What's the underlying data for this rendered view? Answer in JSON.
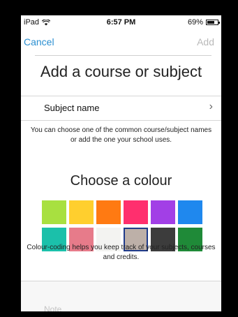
{
  "status_bar": {
    "device": "iPad",
    "time": "6:57 PM",
    "battery": "69%",
    "battery_level": 0.69
  },
  "nav": {
    "cancel_label": "Cancel",
    "add_label": "Add"
  },
  "page_title": "Add a course or subject",
  "subject_row": {
    "label": "Subject name",
    "chevron": "›"
  },
  "help_text": "You can choose one of the common course/subject names or add the one your school uses.",
  "colour_section": {
    "title": "Choose a colour",
    "selected_index": 9,
    "swatches": [
      {
        "name": "lime-green",
        "color": "#a8e040"
      },
      {
        "name": "yellow",
        "color": "#ffcf2e"
      },
      {
        "name": "orange",
        "color": "#ff7a12"
      },
      {
        "name": "pink-red",
        "color": "#ff2f6e"
      },
      {
        "name": "purple",
        "color": "#a23fe6"
      },
      {
        "name": "blue",
        "color": "#1f88ee"
      },
      {
        "name": "teal",
        "color": "#1bc0aa"
      },
      {
        "name": "rose",
        "color": "#e77b8a"
      },
      {
        "name": "white",
        "color": "#f3f3f1"
      },
      {
        "name": "taupe",
        "color": "#bdb0a8"
      },
      {
        "name": "dark-grey",
        "color": "#3c3c3c"
      },
      {
        "name": "green",
        "color": "#1f8a38"
      }
    ]
  },
  "caption": "Colour-coding helps you keep track of your subjects, courses and credits.",
  "note": {
    "placeholder": "Note",
    "value": ""
  }
}
